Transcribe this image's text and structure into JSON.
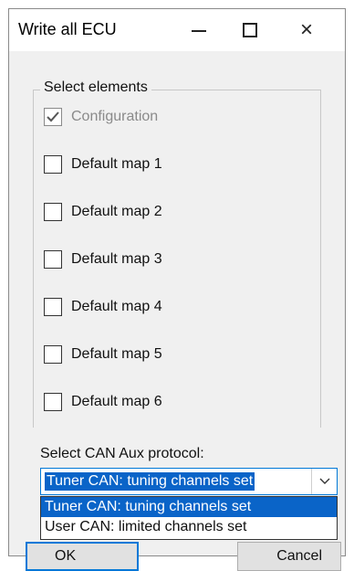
{
  "window": {
    "title": "Write all ECU",
    "buttons": {
      "minimize_icon": "minimize-icon",
      "maximize_icon": "maximize-icon",
      "close_icon": "close-icon",
      "close_glyph": "×"
    }
  },
  "group": {
    "legend": "Select elements",
    "items": [
      {
        "label": "Configuration",
        "checked": true,
        "enabled": false
      },
      {
        "label": "Default map 1",
        "checked": false,
        "enabled": true
      },
      {
        "label": "Default map 2",
        "checked": false,
        "enabled": true
      },
      {
        "label": "Default map 3",
        "checked": false,
        "enabled": true
      },
      {
        "label": "Default map 4",
        "checked": false,
        "enabled": true
      },
      {
        "label": "Default map 5",
        "checked": false,
        "enabled": true
      },
      {
        "label": "Default map 6",
        "checked": false,
        "enabled": true
      }
    ]
  },
  "can": {
    "label": "Select CAN Aux protocol:",
    "selected": "Tuner CAN: tuning channels set",
    "options": [
      "Tuner CAN: tuning channels set",
      "User CAN: limited channels set"
    ]
  },
  "buttons": {
    "ok": "OK",
    "cancel": "Cancel"
  },
  "colors": {
    "accent": "#0078d7",
    "selection": "#0a64c8",
    "window_bg": "#f0f0f0"
  }
}
